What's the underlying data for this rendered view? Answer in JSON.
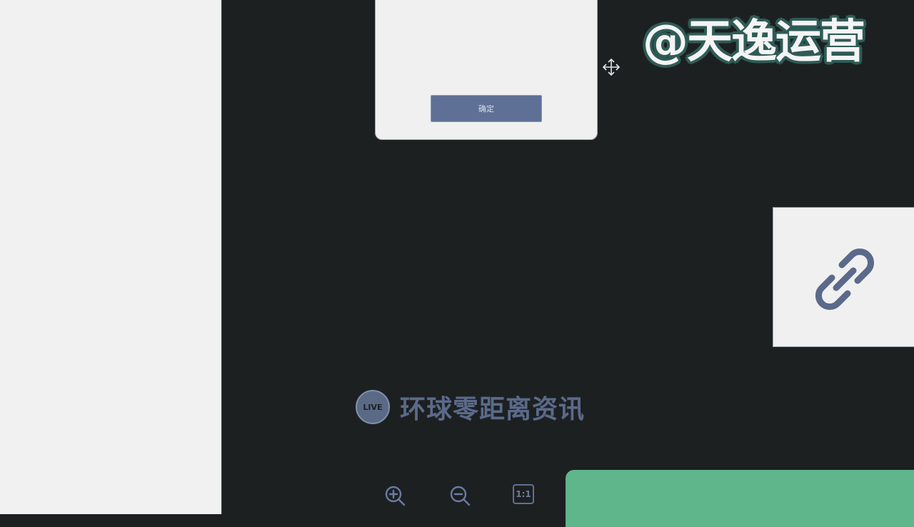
{
  "watermark": {
    "text": "@天逸运营"
  },
  "dialog": {
    "confirm_label": "确定"
  },
  "brand": {
    "name": "环球零距离资讯",
    "logo_text": "LIVE"
  },
  "toolbar": {
    "zoom_in_icon": "zoom-in-icon",
    "zoom_out_icon": "zoom-out-icon",
    "actual_size_label": "1:1"
  },
  "footer_panel": {
    "text": ""
  },
  "colors": {
    "background": "#1d2021",
    "panel": "#f1f1f1",
    "accent": "#5f7096",
    "green": "#5fb68a"
  }
}
